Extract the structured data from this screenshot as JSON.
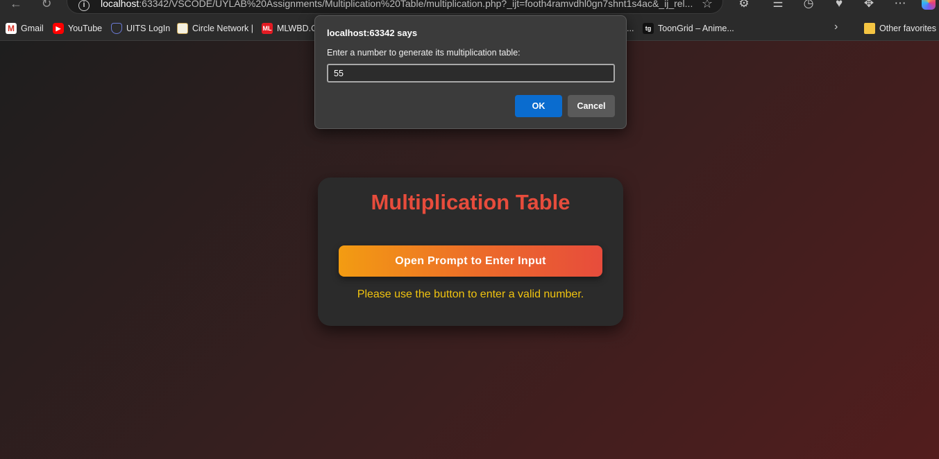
{
  "browser": {
    "url_host": "localhost",
    "url_rest": ":63342/VSCODE/UYLAB%20Assignments/Multiplication%20Table/multiplication.php?_ijt=footh4ramvdhl0gn7shnt1s4ac&_ij_rel...",
    "icons": [
      "back-icon",
      "refresh-icon",
      "info-icon",
      "star-icon",
      "extensions-icon",
      "favorites-icon",
      "history-icon",
      "performance-icon",
      "accessibility-icon",
      "more-icon",
      "copilot-icon"
    ]
  },
  "bookmarks": {
    "items": [
      {
        "label": "Gmail",
        "icon": "gmail-icon",
        "glyph": "M"
      },
      {
        "label": "YouTube",
        "icon": "youtube-icon",
        "glyph": "▶"
      },
      {
        "label": "UITS LogIn",
        "icon": "uits-icon",
        "glyph": ""
      },
      {
        "label": "Circle Network |",
        "icon": "circle-network-icon",
        "glyph": ""
      },
      {
        "label": "MLWBD.C",
        "icon": "mlwbd-icon",
        "glyph": "ML"
      },
      {
        "label": "...",
        "icon": "",
        "glyph": ""
      },
      {
        "label": "ToonGrid – Anime...",
        "icon": "toongrid-icon",
        "glyph": "tg"
      }
    ],
    "other_favorites": "Other favorites"
  },
  "dialog": {
    "title": "localhost:63342 says",
    "message": "Enter a number to generate its multiplication table:",
    "input_value": "55",
    "ok_label": "OK",
    "cancel_label": "Cancel"
  },
  "main": {
    "title": "Multiplication Table",
    "button_label": "Open Prompt to Enter Input",
    "hint": "Please use the button to enter a valid number."
  },
  "colors": {
    "title": "#e74c3c",
    "button_start": "#f39c12",
    "button_end": "#e74c3c",
    "hint": "#f1c40f",
    "ok_button": "#0a6ccf"
  }
}
